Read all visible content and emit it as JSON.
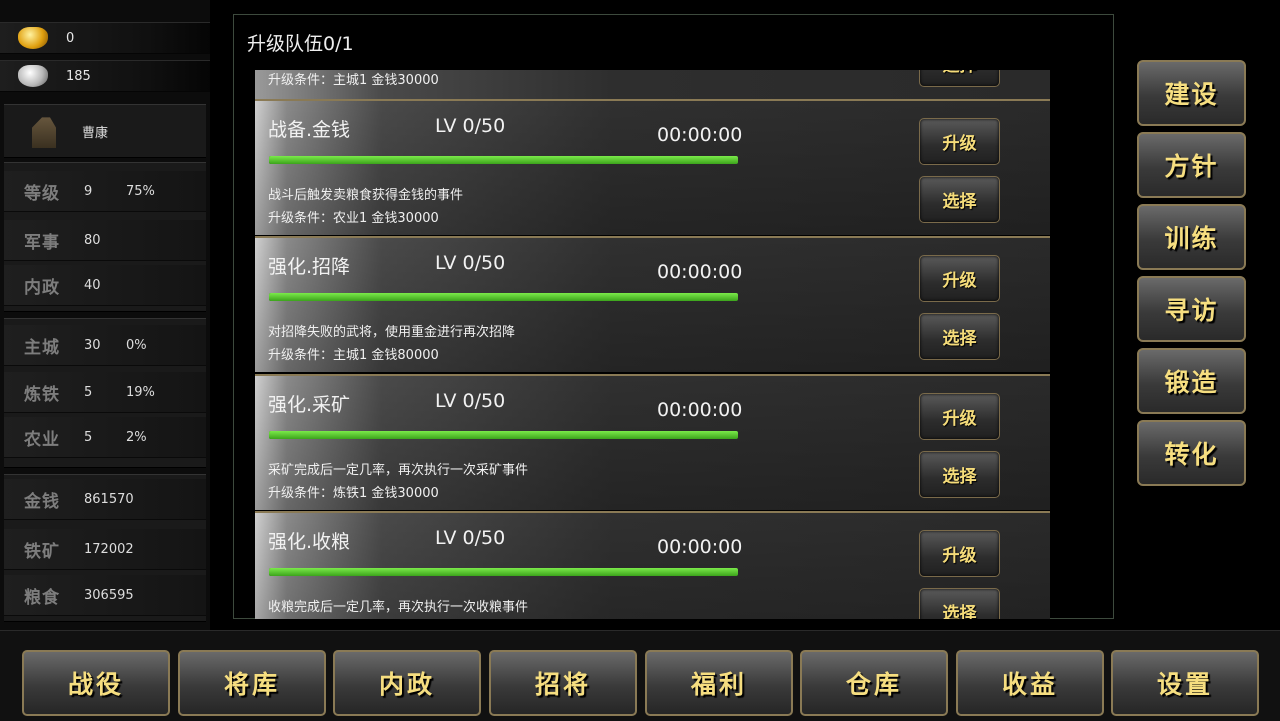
{
  "currencies": [
    {
      "icon": "gold-ingot-icon",
      "value": "0"
    },
    {
      "icon": "silver-ingot-icon",
      "value": "185"
    }
  ],
  "hero": {
    "name": "曹康"
  },
  "level": {
    "label": "等级",
    "value": "9",
    "percent": "75%"
  },
  "military": {
    "label": "军事",
    "value": "80"
  },
  "politics": {
    "label": "内政",
    "value": "40"
  },
  "buildings": [
    {
      "label": "主城",
      "value": "30",
      "percent": "0%"
    },
    {
      "label": "炼铁",
      "value": "5",
      "percent": "19%"
    },
    {
      "label": "农业",
      "value": "5",
      "percent": "2%"
    }
  ],
  "resources": [
    {
      "label": "金钱",
      "value": "861570"
    },
    {
      "label": "铁矿",
      "value": "172002"
    },
    {
      "label": "粮食",
      "value": "306595"
    }
  ],
  "panel": {
    "title": "升级队伍0/1",
    "partial_condition": "升级条件：主城1 金钱30000",
    "upgrade_label": "升级",
    "select_label": "选择",
    "items": [
      {
        "name": "战备.金钱",
        "level": "LV 0/50",
        "time": "00:00:00",
        "progress": 1.0,
        "desc": "战斗后触发卖粮食获得金钱的事件",
        "condition": "升级条件：农业1 金钱30000"
      },
      {
        "name": "强化.招降",
        "level": "LV 0/50",
        "time": "00:00:00",
        "progress": 1.0,
        "desc": "对招降失败的武将，使用重金进行再次招降",
        "condition": "升级条件：主城1 金钱80000"
      },
      {
        "name": "强化.采矿",
        "level": "LV 0/50",
        "time": "00:00:00",
        "progress": 1.0,
        "desc": "采矿完成后一定几率，再次执行一次采矿事件",
        "condition": "升级条件：炼铁1 金钱30000"
      },
      {
        "name": "强化.收粮",
        "level": "LV 0/50",
        "time": "00:00:00",
        "progress": 1.0,
        "desc": "收粮完成后一定几率，再次执行一次收粮事件",
        "condition": ""
      }
    ]
  },
  "right_menu": [
    "建设",
    "方针",
    "训练",
    "寻访",
    "锻造",
    "转化"
  ],
  "bottom_nav": [
    "战役",
    "将库",
    "内政",
    "招将",
    "福利",
    "仓库",
    "收益",
    "设置"
  ]
}
